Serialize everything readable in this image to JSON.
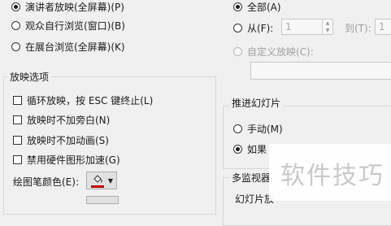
{
  "show_type": {
    "presenter": "演讲者放映(全屏幕)(P)",
    "window": "观众自行浏览(窗口)(B)",
    "kiosk": "在展台浏览(全屏幕)(K)"
  },
  "show_options": {
    "title": "放映选项",
    "loop": "循环放映，按 ESC 键终止(L)",
    "no_narration": "放映时不加旁白(N)",
    "no_animation": "放映时不加动画(S)",
    "disable_hw": "禁用硬件图形加速(G)",
    "pen_color": "绘图笔颜色(E):",
    "pen_color_value": "#c00000"
  },
  "slides": {
    "all": "全部(A)",
    "from": "从(F):",
    "from_value": "1",
    "to": "到(T):",
    "to_value": "1",
    "custom": "自定义放映(C):"
  },
  "advance": {
    "title": "推进幻灯片",
    "manual": "手动(M)",
    "timings": "如果"
  },
  "monitors": {
    "title": "多监视器",
    "slide_show_monitor": "幻灯片放"
  },
  "watermark": "软件技巧"
}
